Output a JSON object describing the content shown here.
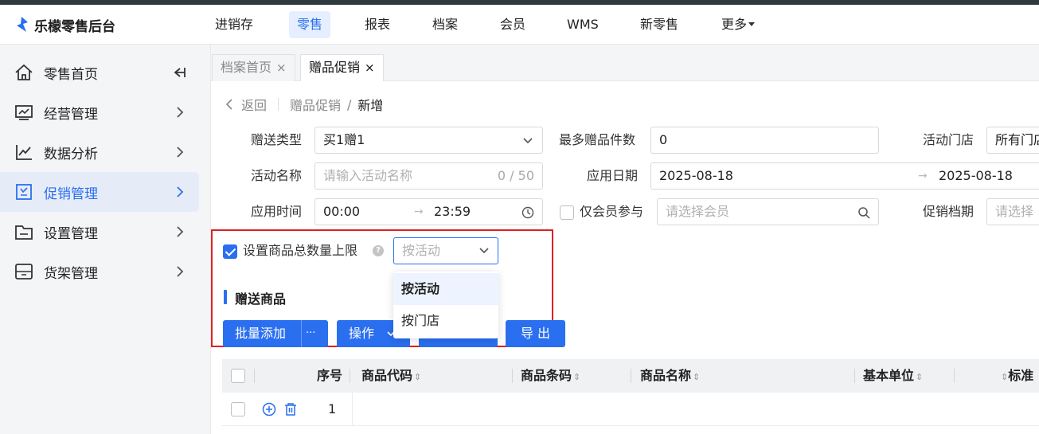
{
  "app": {
    "title": "乐檬零售后台"
  },
  "topnav": [
    {
      "label": "进销存"
    },
    {
      "label": "零售"
    },
    {
      "label": "报表"
    },
    {
      "label": "档案"
    },
    {
      "label": "会员"
    },
    {
      "label": "WMS"
    },
    {
      "label": "新零售"
    },
    {
      "label": "更多"
    }
  ],
  "topnav_active": "零售",
  "sidebar": {
    "items": [
      {
        "label": "零售首页",
        "icon": "home-icon"
      },
      {
        "label": "经营管理",
        "icon": "monitor-chart-icon"
      },
      {
        "label": "数据分析",
        "icon": "line-chart-icon"
      },
      {
        "label": "促销管理",
        "icon": "promotion-icon"
      },
      {
        "label": "设置管理",
        "icon": "folder-icon"
      },
      {
        "label": "货架管理",
        "icon": "shelf-icon"
      }
    ],
    "active": "促销管理"
  },
  "tabs": [
    {
      "label": "档案首页",
      "close": "×"
    },
    {
      "label": "赠品促销",
      "close": "×"
    }
  ],
  "breadcrumb": {
    "back": "返回",
    "parent": "赠品促销",
    "sep": "/",
    "current": "新增"
  },
  "form": {
    "gift_type": {
      "label": "赠送类型",
      "value": "买1赠1"
    },
    "max_gift": {
      "label": "最多赠品件数",
      "value": "0"
    },
    "store": {
      "label": "活动门店",
      "value": "所有门店"
    },
    "activity_name": {
      "label": "活动名称",
      "placeholder": "请输入活动名称",
      "count": "0 / 50"
    },
    "apply_date": {
      "label": "应用日期",
      "start": "2025-08-18",
      "arrow": "→",
      "end": "2025-08-18"
    },
    "apply_time": {
      "label": "应用时间",
      "start": "00:00",
      "arrow": "→",
      "end": "23:59"
    },
    "member_only": {
      "label": "仅会员参与",
      "placeholder": "请选择会员"
    },
    "promo_level": {
      "label": "促销档期",
      "placeholder": "请选择"
    },
    "limit_total": {
      "label": "设置商品总数量上限",
      "help": "?",
      "select_placeholder": "按活动"
    }
  },
  "dropdown": {
    "options": [
      "按活动",
      "按门店"
    ],
    "highlighted": "按活动"
  },
  "section": {
    "title": "赠送商品"
  },
  "buttons": {
    "batch_add": "批量添加",
    "more": "···",
    "operation": "操作",
    "export": "导 出"
  },
  "table": {
    "headers": [
      "序号",
      "商品代码",
      "商品条码",
      "商品名称",
      "基本单位",
      "标准"
    ],
    "rows": [
      {
        "index": "1"
      }
    ]
  },
  "colors": {
    "accent": "#2a6ff0",
    "highlight_box": "#e02020"
  }
}
